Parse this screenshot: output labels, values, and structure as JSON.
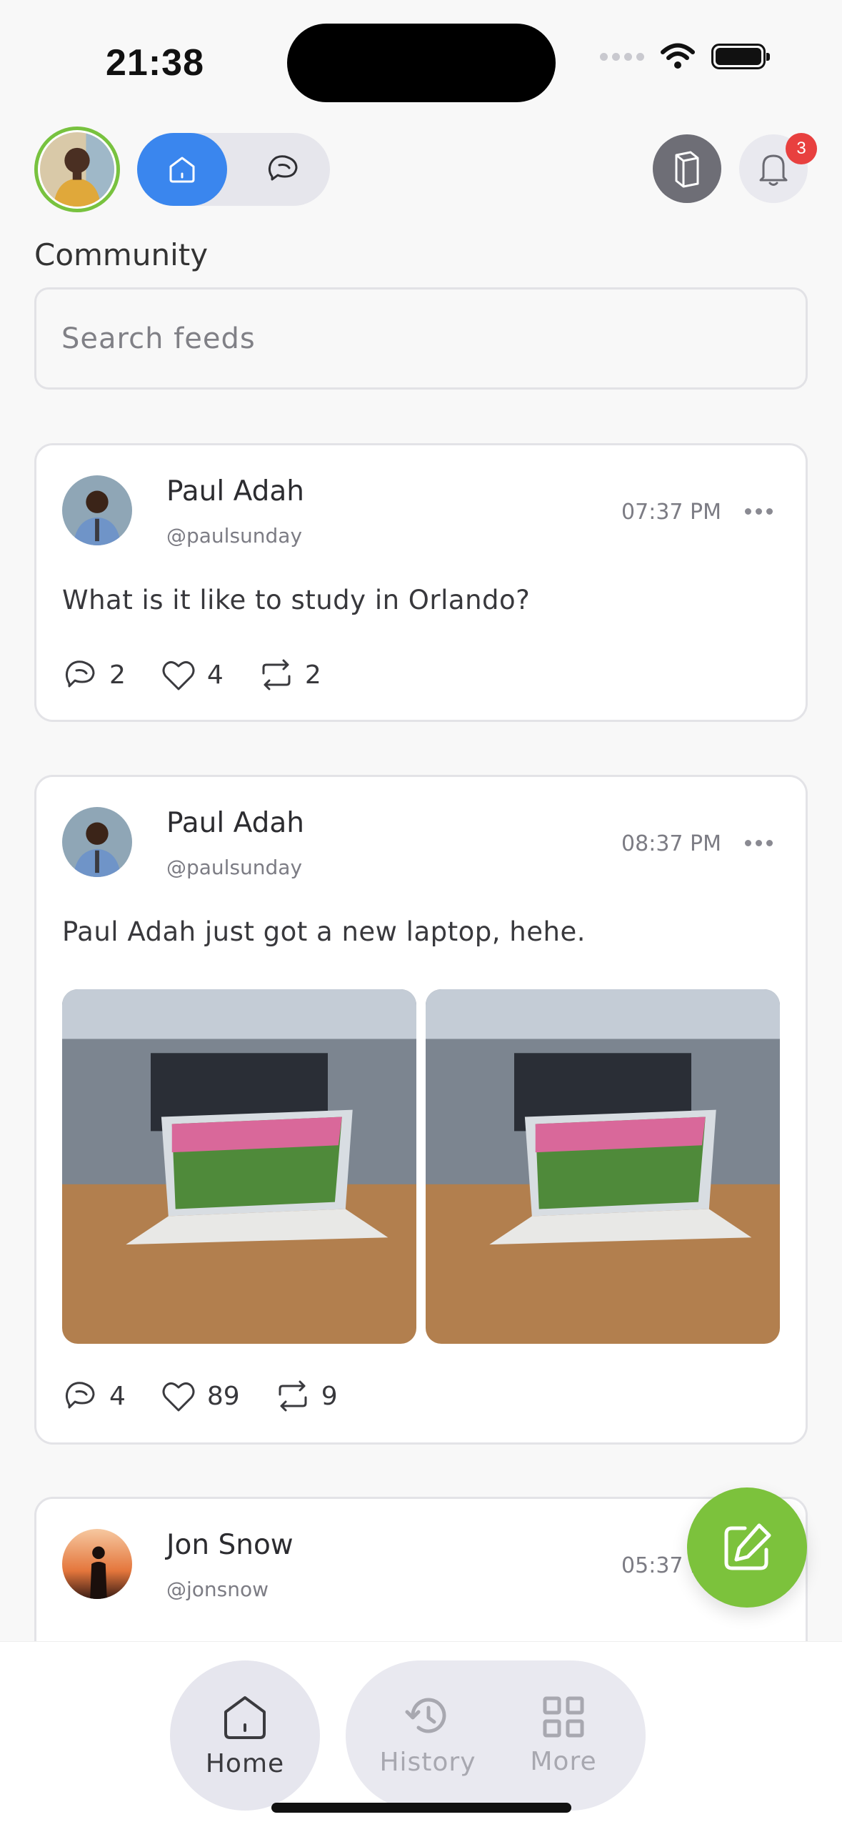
{
  "status_bar": {
    "time": "21:38"
  },
  "header": {
    "notification_count": "3",
    "section_title": "Community"
  },
  "search": {
    "placeholder": "Search feeds"
  },
  "posts": [
    {
      "name": "Paul Adah",
      "handle": "@paulsunday",
      "time": "07:37 PM",
      "text": "What is it like to study in Orlando?",
      "comments": "2",
      "likes": "4",
      "reposts": "2"
    },
    {
      "name": "Paul Adah",
      "handle": "@paulsunday",
      "time": "08:37 PM",
      "text": "Paul Adah just got a new laptop, hehe.",
      "comments": "4",
      "likes": "89",
      "reposts": "9"
    },
    {
      "name": "Jon Snow",
      "handle": "@jonsnow",
      "time": "05:37 PM"
    }
  ],
  "bottom_nav": {
    "home": "Home",
    "history": "History",
    "more": "More"
  },
  "colors": {
    "accent_blue": "#3a86ee",
    "accent_green": "#7cc23c",
    "badge_red": "#e8403f"
  },
  "icons": [
    "home-icon",
    "chat-icon",
    "book-icon",
    "bell-icon",
    "comment-icon",
    "heart-icon",
    "repost-icon",
    "more-icon",
    "edit-icon",
    "history-icon",
    "grid-icon"
  ]
}
